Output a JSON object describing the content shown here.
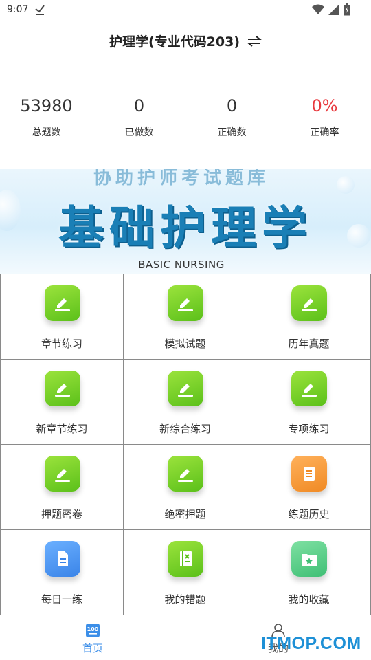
{
  "status_bar": {
    "time": "9:07",
    "icons": [
      "download-done-icon",
      "wifi-icon",
      "signal-icon",
      "battery-icon"
    ]
  },
  "header": {
    "title": "护理学(专业代码203)",
    "switch_icon": "swap-arrows-icon"
  },
  "stats": [
    {
      "value": "53980",
      "label": "总题数"
    },
    {
      "value": "0",
      "label": "已做数"
    },
    {
      "value": "0",
      "label": "正确数"
    },
    {
      "value": "0%",
      "label": "正确率",
      "color": "#e8383d"
    }
  ],
  "banner": {
    "top_text": "协助护师考试题库",
    "title": "基础护理学",
    "subtitle": "BASIC NURSING"
  },
  "grid": {
    "items": [
      {
        "label": "章节练习",
        "icon": "edit-pen-icon",
        "color": "green"
      },
      {
        "label": "模拟试题",
        "icon": "edit-pen-icon",
        "color": "green"
      },
      {
        "label": "历年真题",
        "icon": "edit-pen-icon",
        "color": "green"
      },
      {
        "label": "新章节练习",
        "icon": "edit-pen-icon",
        "color": "green"
      },
      {
        "label": "新综合练习",
        "icon": "edit-pen-icon",
        "color": "green"
      },
      {
        "label": "专项练习",
        "icon": "edit-pen-icon",
        "color": "green"
      },
      {
        "label": "押题密卷",
        "icon": "edit-pen-icon",
        "color": "green"
      },
      {
        "label": "绝密押题",
        "icon": "edit-pen-icon",
        "color": "green"
      },
      {
        "label": "练题历史",
        "icon": "history-scroll-icon",
        "color": "orange"
      },
      {
        "label": "每日一练",
        "icon": "document-icon",
        "color": "blue"
      },
      {
        "label": "我的错题",
        "icon": "notebook-icon",
        "color": "green"
      },
      {
        "label": "我的收藏",
        "icon": "star-folder-icon",
        "color": "teal"
      }
    ]
  },
  "bottom_nav": {
    "items": [
      {
        "label": "首页",
        "icon": "home-100-icon",
        "active": true
      },
      {
        "label": "我的",
        "icon": "person-icon",
        "active": false
      }
    ],
    "active_color": "#3b8ee8"
  },
  "watermark": "ITMOP.COM"
}
